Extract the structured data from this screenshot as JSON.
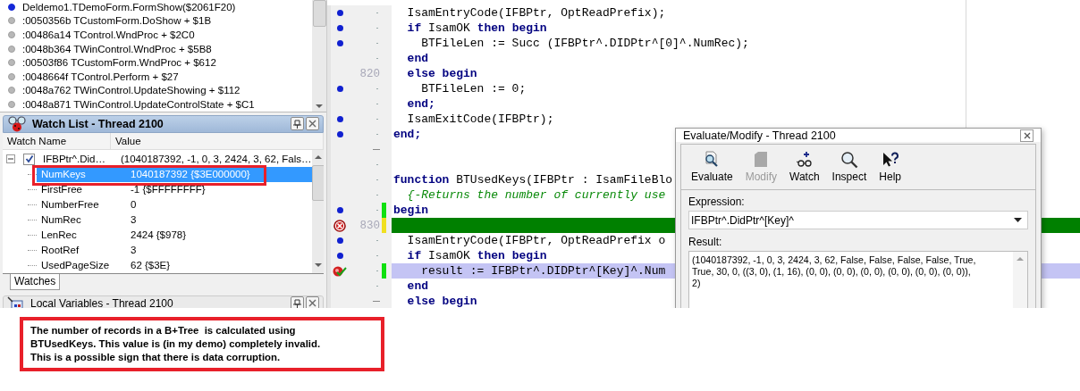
{
  "call_stack": {
    "frames": [
      {
        "text": "Deldemo1.TDemoForm.FormShow($2061F20)",
        "current": true
      },
      {
        "text": ":0050356b TCustomForm.DoShow + $1B",
        "current": false
      },
      {
        "text": ":00486a14 TControl.WndProc + $2C0",
        "current": false
      },
      {
        "text": ":0048b364 TWinControl.WndProc + $5B8",
        "current": false
      },
      {
        "text": ":00503f86 TCustomForm.WndProc + $612",
        "current": false
      },
      {
        "text": ":0048664f TControl.Perform + $27",
        "current": false
      },
      {
        "text": ":0048a762 TWinControl.UpdateShowing + $112",
        "current": false
      },
      {
        "text": ":0048a871 TWinControl.UpdateControlState + $C1",
        "current": false
      }
    ]
  },
  "watch_list": {
    "title": "Watch List - Thread 2100",
    "columns": [
      "Watch Name",
      "Value"
    ],
    "items": [
      {
        "name": "IFBPtr^.Did…",
        "value": "(1040187392, -1, 0, 3, 2424, 3, 62, Fals…",
        "checked": true,
        "expanded": true,
        "selected": false,
        "children": [
          {
            "name": "NumKeys",
            "value": "1040187392 {$3E000000}",
            "selected": true
          },
          {
            "name": "FirstFree",
            "value": "-1 {$FFFFFFFF}",
            "selected": false
          },
          {
            "name": "NumberFree",
            "value": "0",
            "selected": false
          },
          {
            "name": "NumRec",
            "value": "3",
            "selected": false
          },
          {
            "name": "LenRec",
            "value": "2424 {$978}",
            "selected": false
          },
          {
            "name": "RootRef",
            "value": "3",
            "selected": false
          },
          {
            "name": "UsedPageSize",
            "value": "62 {$3E}",
            "selected": false
          }
        ]
      }
    ],
    "tabs": [
      {
        "label": "Watches",
        "selected": true
      }
    ]
  },
  "local_variables": {
    "title": "Local Variables - Thread 2100"
  },
  "editor": {
    "lines": [
      {
        "code_dot": true,
        "fold": false,
        "kind": "code",
        "text": "  IsamEntryCode(IFBPtr, OptReadPrefix);"
      },
      {
        "code_dot": true,
        "fold": false,
        "kind": "code",
        "text": "  **if** IsamOK **then begin**"
      },
      {
        "code_dot": true,
        "fold": false,
        "kind": "code",
        "text": "    BTFileLen := Succ (IFBPtr^.DIDPtr^[0]^.NumRec);"
      },
      {
        "code_dot": false,
        "fold": false,
        "kind": "keyword",
        "text": "  end"
      },
      {
        "code_dot": false,
        "number": "820",
        "kind": "keyword",
        "text": "  else begin"
      },
      {
        "code_dot": true,
        "fold": false,
        "kind": "code",
        "text": "    BTFileLen := 0;"
      },
      {
        "code_dot": false,
        "fold": false,
        "kind": "keyword",
        "text": "  end;"
      },
      {
        "code_dot": true,
        "fold": false,
        "kind": "code",
        "text": "  IsamExitCode(IFBPtr);"
      },
      {
        "code_dot": true,
        "fold": false,
        "kind": "keyword",
        "text": "end;"
      },
      {
        "code_dot": false,
        "fold": true
      },
      {
        "code_dot": false,
        "fold": false
      },
      {
        "code_dot": false,
        "fold": false,
        "kind": "code",
        "text": "**function** BTUsedKeys(IFBPtr : IsamFileBlo"
      },
      {
        "code_dot": false,
        "fold": false,
        "kind": "comment",
        "text": "  {-Returns the number of currently use"
      },
      {
        "code_dot": true,
        "fold": false,
        "modified": true,
        "saved": true,
        "kind": "keyword",
        "text": "begin"
      },
      {
        "breakpoint": true,
        "number": "830",
        "modified": true,
        "saved": false
      },
      {
        "code_dot": true,
        "fold": false,
        "kind": "code",
        "text": "  IsamEntryCode(IFBPtr, OptReadPrefix o"
      },
      {
        "code_dot": true,
        "fold": false,
        "kind": "code",
        "text": "  **if** IsamOK **then begin**"
      },
      {
        "breakpoint_verified": true,
        "fold": false,
        "modified": true,
        "saved": true,
        "kind": "code",
        "text": "    result := IFBPtr^.DIDPtr^[Key]^.Num"
      },
      {
        "code_dot": false,
        "fold": false,
        "kind": "keyword",
        "text": "  end"
      },
      {
        "code_dot": false,
        "fold": true,
        "kind": "keyword",
        "text": "  else begin"
      }
    ]
  },
  "evaluate_dialog": {
    "title": "Evaluate/Modify - Thread 2100",
    "tools": [
      {
        "label": "Evaluate",
        "kind": "evaluate",
        "disabled": false
      },
      {
        "label": "Modify",
        "kind": "modify",
        "disabled": true
      },
      {
        "label": "Watch",
        "kind": "watch",
        "disabled": false
      },
      {
        "label": "Inspect",
        "kind": "inspect",
        "disabled": false
      },
      {
        "label": "Help",
        "kind": "help",
        "disabled": false
      }
    ],
    "expression_label": "Expression:",
    "expression": "IFBPtr^.DidPtr^[Key]^",
    "result_label": "Result:",
    "result": "(1040187392, -1, 0, 3, 2424, 3, 62, False, False, False, False, True,\nTrue, 30, 0, ((3, 0), (1, 16), (0, 0), (0, 0), (0, 0), (0, 0), (0, 0), (0, 0)),\n2)"
  },
  "note": {
    "text": "The number of records in a B+Tree  is calculated using\nBTUsedKeys. This value is (in my demo) completely invalid.\nThis is a possible sign that there is data corruption."
  }
}
